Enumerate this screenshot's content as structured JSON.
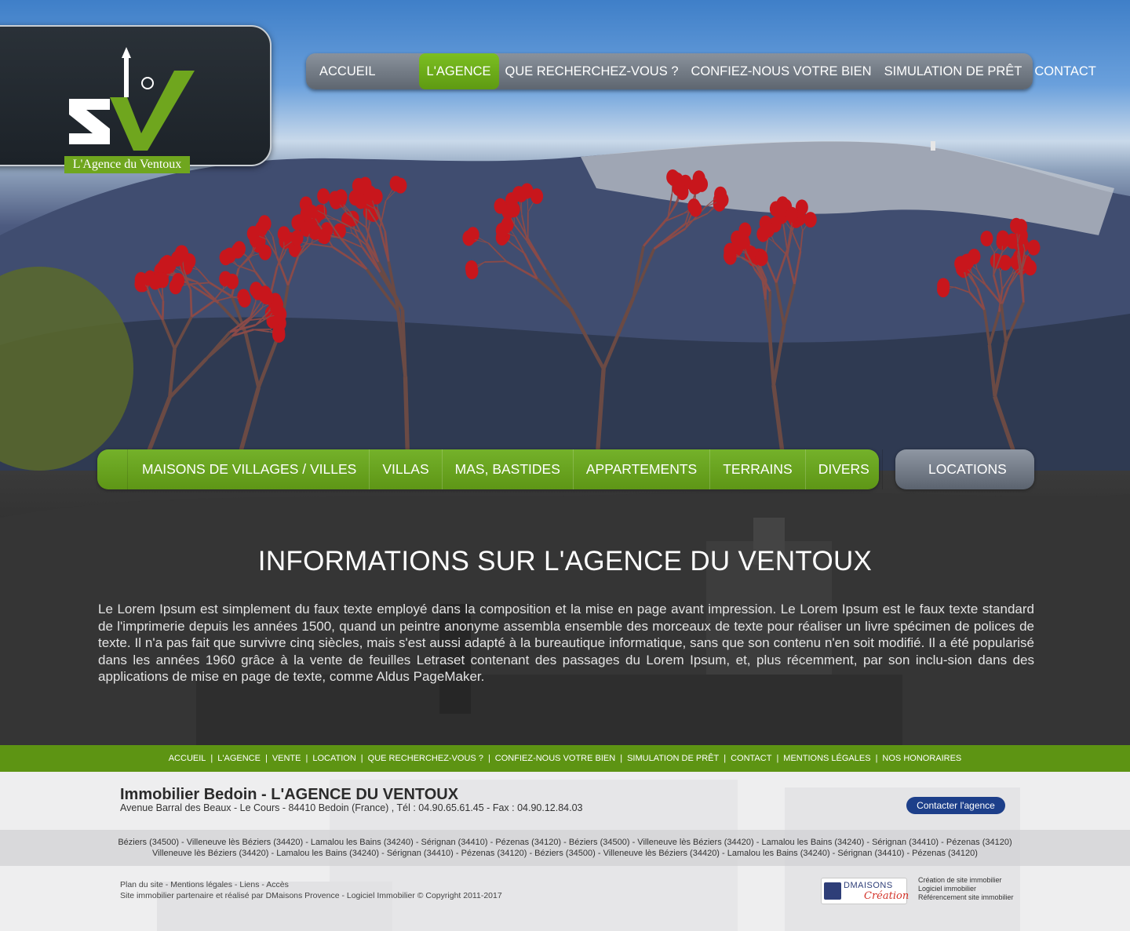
{
  "brand": {
    "logo_caption": "L'Agence du Ventoux",
    "logo_letters": "AV"
  },
  "topnav": {
    "items": [
      "ACCUEIL",
      "L'AGENCE",
      "QUE RECHERCHEZ-VOUS ?",
      "CONFIEZ-NOUS VOTRE BIEN",
      "SIMULATION DE PRÊT",
      "CONTACT"
    ],
    "active": "L'AGENCE"
  },
  "categories": {
    "items": [
      "MAISONS DE VILLAGES / VILLES",
      "VILLAS",
      "MAS, BASTIDES",
      "APPARTEMENTS",
      "TERRAINS",
      "DIVERS"
    ],
    "locations": "LOCATIONS"
  },
  "info": {
    "title": "INFORMATIONS SUR L'AGENCE DU VENTOUX",
    "body": "Le Lorem Ipsum est simplement du faux texte employé dans la composition et la mise en page avant impression. Le Lorem Ipsum est le faux texte standard de l'imprimerie depuis les années 1500, quand un peintre anonyme assembla ensemble des morceaux de texte pour réaliser un livre spécimen de polices de texte. Il n'a pas fait que survivre cinq siècles, mais s'est aussi adapté à la bureautique informatique, sans que son contenu n'en soit modifié. Il a été popularisé dans les années 1960 grâce à la vente de feuilles Letraset contenant des passages du Lorem Ipsum, et, plus récemment, par son inclu-sion dans des applications de mise en page de texte, comme Aldus PageMaker."
  },
  "footer_nav": {
    "items": [
      "ACCUEIL",
      "L'AGENCE",
      "VENTE",
      "LOCATION",
      "QUE RECHERCHEZ-VOUS ?",
      "CONFIEZ-NOUS VOTRE BIEN",
      "SIMULATION DE PRÊT",
      "CONTACT",
      "MENTIONS LÉGALES",
      "NOS HONORAIRES"
    ]
  },
  "footer": {
    "title": "Immobilier Bedoin - L'AGENCE DU VENTOUX",
    "address": "Avenue Barral des Beaux - Le Cours - 84410 Bedoin (France) , Tél : 04.90.65.61.45 - Fax : 04.90.12.84.03",
    "contact_button": "Contacter l'agence",
    "cities_line1": "Béziers (34500) - Villeneuve lès Béziers (34420) - Lamalou les Bains (34240) - Sérignan (34410) - Pézenas (34120) - Béziers (34500) - Villeneuve lès Béziers (34420) - Lamalou les Bains (34240) - Sérignan (34410) - Pézenas (34120)",
    "cities_line2": "Villeneuve lès Béziers (34420) - Lamalou les Bains (34240) - Sérignan (34410) - Pézenas (34120) - Béziers (34500) - Villeneuve lès Béziers (34420) - Lamalou les Bains (34240) - Sérignan (34410) - Pézenas (34120)",
    "links": [
      "Plan du site",
      "Mentions légales",
      "Liens",
      "Accès"
    ],
    "copyright": "Site immobilier partenaire et réalisé par DMaisons Provence - Logiciel Immobilier © Copyright 2011-2017",
    "dm_logo_top": "DMAISONS",
    "dm_logo_script": "Création",
    "dm_text": [
      "Création de site immobilier",
      "Logiciel immobilier",
      "Référencement site immobilier"
    ]
  },
  "colors": {
    "accent_green": "#6fa61e",
    "nav_grey": "#6b737d",
    "button_blue": "#1d3f8a"
  }
}
